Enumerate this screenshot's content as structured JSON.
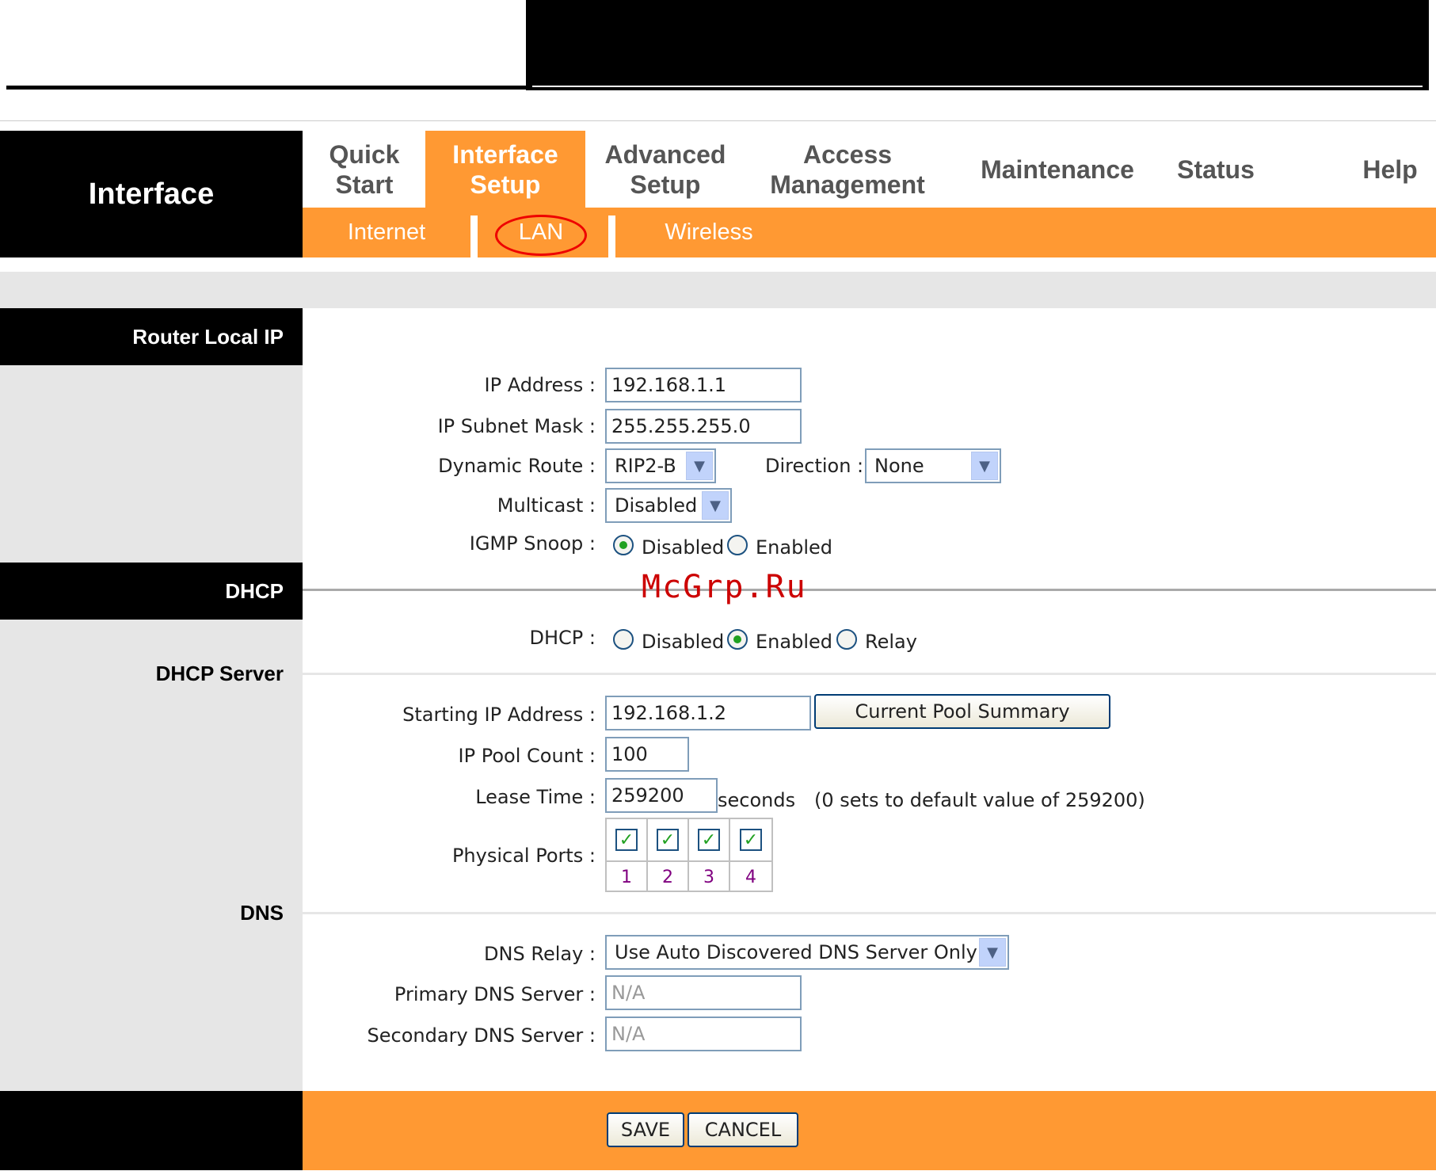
{
  "header": {
    "section_title": "Interface"
  },
  "nav": {
    "tabs": [
      {
        "label": "Quick\nStart"
      },
      {
        "label": "Interface\nSetup"
      },
      {
        "label": "Advanced\nSetup"
      },
      {
        "label": "Access\nManagement"
      },
      {
        "label": "Maintenance"
      },
      {
        "label": "Status"
      },
      {
        "label": "Help"
      }
    ],
    "subtabs": [
      {
        "label": "Internet"
      },
      {
        "label": "LAN"
      },
      {
        "label": "Wireless"
      }
    ]
  },
  "router_local_ip": {
    "title": "Router Local IP",
    "ip_address_label": "IP Address :",
    "ip_address": "192.168.1.1",
    "subnet_mask_label": "IP Subnet Mask :",
    "subnet_mask": "255.255.255.0",
    "dynamic_route_label": "Dynamic Route :",
    "dynamic_route": "RIP2-B",
    "direction_label": "Direction :",
    "direction": "None",
    "multicast_label": "Multicast :",
    "multicast": "Disabled",
    "igmp_label": "IGMP Snoop :",
    "igmp_disabled": "Disabled",
    "igmp_enabled": "Enabled"
  },
  "dhcp": {
    "title": "DHCP",
    "dhcp_label": "DHCP :",
    "opt_disabled": "Disabled",
    "opt_enabled": "Enabled",
    "opt_relay": "Relay",
    "server_title": "DHCP Server",
    "start_ip_label": "Starting IP Address :",
    "start_ip": "192.168.1.2",
    "pool_summary_button": "Current Pool Summary",
    "pool_count_label": "IP Pool Count :",
    "pool_count": "100",
    "lease_label": "Lease Time :",
    "lease_time": "259200",
    "lease_unit": "seconds",
    "lease_note": "(0 sets to default value of 259200)",
    "ports_label": "Physical Ports :",
    "ports": [
      "1",
      "2",
      "3",
      "4"
    ]
  },
  "dns": {
    "title": "DNS",
    "relay_label": "DNS Relay :",
    "relay": "Use Auto Discovered DNS Server Only",
    "primary_label": "Primary DNS Server :",
    "primary": "N/A",
    "secondary_label": "Secondary DNS Server :",
    "secondary": "N/A"
  },
  "footer": {
    "save": "SAVE",
    "cancel": "CANCEL"
  },
  "watermark": "McGrp.Ru",
  "colors": {
    "accent": "#ff9933",
    "highlight": "#e00000"
  }
}
